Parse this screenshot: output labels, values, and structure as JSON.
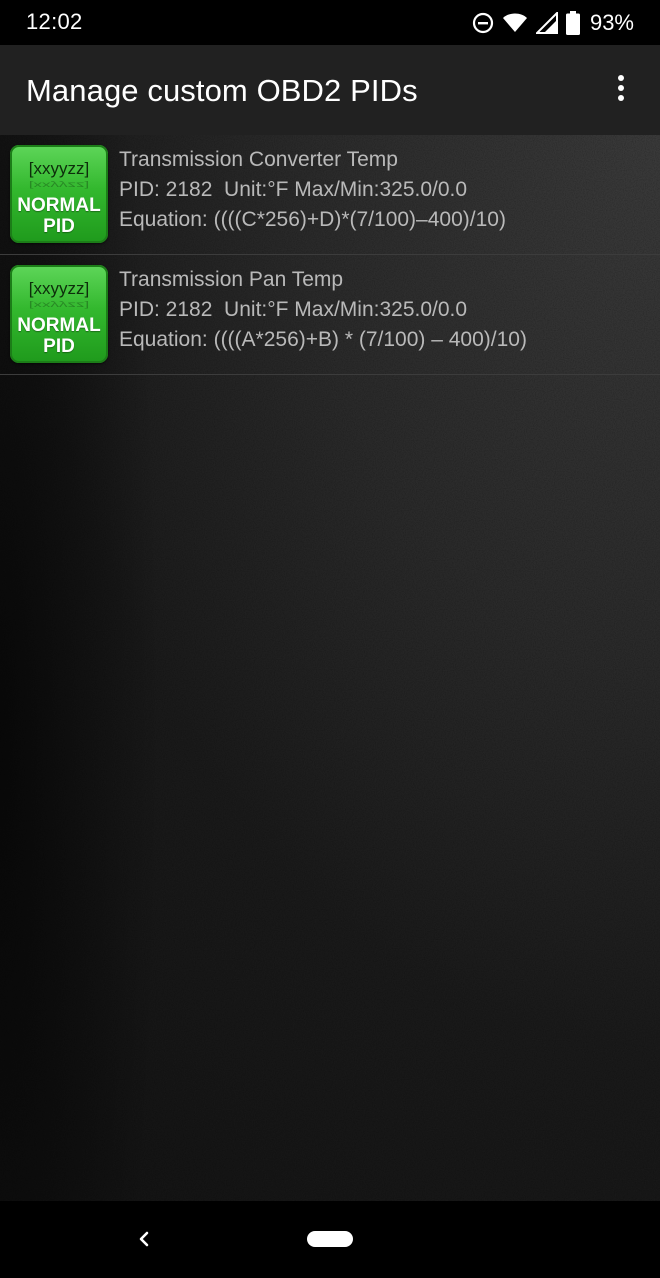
{
  "status_bar": {
    "time": "12:02",
    "battery_percent": "93%",
    "icons": [
      "do-not-disturb-icon",
      "wifi-icon",
      "cellular-signal-icon",
      "battery-icon"
    ]
  },
  "app_bar": {
    "title": "Manage custom OBD2 PIDs",
    "overflow_icon": "more-vert-icon"
  },
  "pids": [
    {
      "badge_code": "[xxyyzz]",
      "badge_type_line1": "NORMAL",
      "badge_type_line2": "PID",
      "name": "Transmission Converter Temp",
      "details": "PID: 2182  Unit:°F Max/Min:325.0/0.0",
      "equation": "Equation: ((((C*256)+D)*(7/100)–400)/10)"
    },
    {
      "badge_code": "[xxyyzz]",
      "badge_type_line1": "NORMAL",
      "badge_type_line2": "PID",
      "name": "Transmission Pan Temp",
      "details": "PID: 2182  Unit:°F Max/Min:325.0/0.0",
      "equation": "Equation: ((((A*256)+B) * (7/100) – 400)/10)"
    }
  ],
  "nav_bar": {
    "back_icon": "back-chevron-icon",
    "home_icon": "home-pill-icon"
  },
  "colors": {
    "app_bar": "#212121",
    "badge_green": "#33b82e",
    "list_text": "#b9b9b9"
  }
}
